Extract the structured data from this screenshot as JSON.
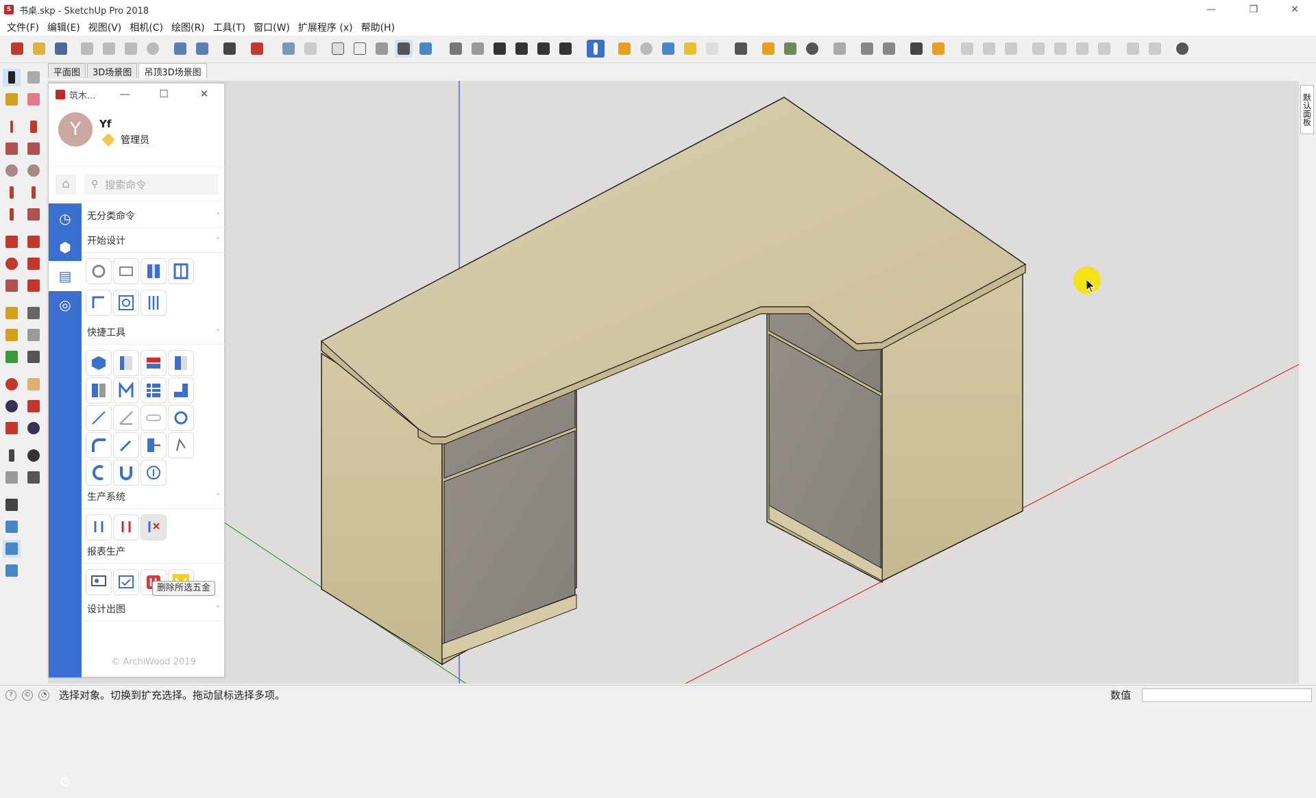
{
  "window": {
    "title": "书桌.skp - SketchUp Pro 2018",
    "minimize": "—",
    "maximize": "❐",
    "close": "✕"
  },
  "menu": [
    "文件(F)",
    "编辑(E)",
    "视图(V)",
    "相机(C)",
    "绘图(R)",
    "工具(T)",
    "窗口(W)",
    "扩展程序 (x)",
    "帮助(H)"
  ],
  "scene_tabs": [
    {
      "label": "平面图",
      "active": false
    },
    {
      "label": "3D场景图",
      "active": false
    },
    {
      "label": "吊顶3D场景图",
      "active": true
    }
  ],
  "right_tray": {
    "label": "默认面板"
  },
  "panel": {
    "title": "筑木...",
    "min": "—",
    "max": "☐",
    "close": "✕",
    "user": {
      "avatar": "Y",
      "name": "Yf",
      "role": "管理员"
    },
    "search_placeholder": "搜索命令",
    "sections": [
      "无分类命令",
      "开始设计",
      "快捷工具",
      "生产系统",
      "报表生产",
      "设计出图"
    ],
    "tooltip": "删除所选五金",
    "copyright": "© ArchiWood 2019"
  },
  "status": {
    "message": "选择对象。切换到扩充选择。拖动鼠标选择多项。",
    "value_label": "数值",
    "value": ""
  },
  "colors": {
    "accent_blue": "#3a6fcf",
    "wood": "#d2c7a5",
    "door": "#8f8b84",
    "bg": "#dedddb",
    "cursor_highlight": "#f7e200"
  }
}
